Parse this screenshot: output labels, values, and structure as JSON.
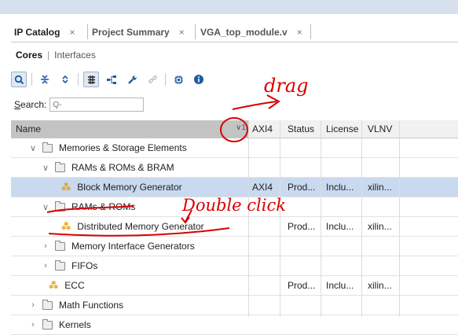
{
  "tabs": [
    {
      "label": "IP Catalog",
      "close": "×",
      "active": true
    },
    {
      "label": "Project Summary",
      "close": "×",
      "active": false
    },
    {
      "label": "VGA_top_module.v",
      "close": "×",
      "active": false
    }
  ],
  "subnav": {
    "cores": "Cores",
    "separator": "|",
    "interfaces": "Interfaces"
  },
  "toolbar_icons": [
    "search-icon",
    "collapse-all-icon",
    "expand-all-icon",
    "filter-icon",
    "hierarchy-icon",
    "wrench-icon",
    "link-icon",
    "chip-icon",
    "info-icon"
  ],
  "search": {
    "label_prefix": "S",
    "label_rest": "earch:",
    "placeholder": "Q-"
  },
  "table": {
    "columns": [
      "Name",
      "AXI4",
      "Status",
      "License",
      "VLNV"
    ],
    "sort_indicator": "1",
    "rows": [
      {
        "name": "Memories & Storage Elements",
        "axi": "",
        "status": "",
        "license": "",
        "vlnv": ""
      },
      {
        "name": "RAMs & ROMs & BRAM",
        "axi": "",
        "status": "",
        "license": "",
        "vlnv": ""
      },
      {
        "name": "Block Memory Generator",
        "axi": "AXI4",
        "status": "Prod...",
        "license": "Inclu...",
        "vlnv": "xilin..."
      },
      {
        "name": "RAMs & ROMs",
        "axi": "",
        "status": "",
        "license": "",
        "vlnv": ""
      },
      {
        "name": "Distributed Memory Generator",
        "axi": "",
        "status": "Prod...",
        "license": "Inclu...",
        "vlnv": "xilin..."
      },
      {
        "name": "Memory Interface Generators",
        "axi": "",
        "status": "",
        "license": "",
        "vlnv": ""
      },
      {
        "name": "FIFOs",
        "axi": "",
        "status": "",
        "license": "",
        "vlnv": ""
      },
      {
        "name": "ECC",
        "axi": "",
        "status": "Prod...",
        "license": "Inclu...",
        "vlnv": "xilin..."
      },
      {
        "name": "Math Functions",
        "axi": "",
        "status": "",
        "license": "",
        "vlnv": ""
      },
      {
        "name": "Kernels",
        "axi": "",
        "status": "",
        "license": "",
        "vlnv": ""
      }
    ]
  },
  "annotations": {
    "drag": "drag",
    "double_click": "Double click"
  },
  "colors": {
    "selected_row": "#c9d9ef",
    "annotation": "#d90000",
    "ip_icon": "#e39a00"
  }
}
